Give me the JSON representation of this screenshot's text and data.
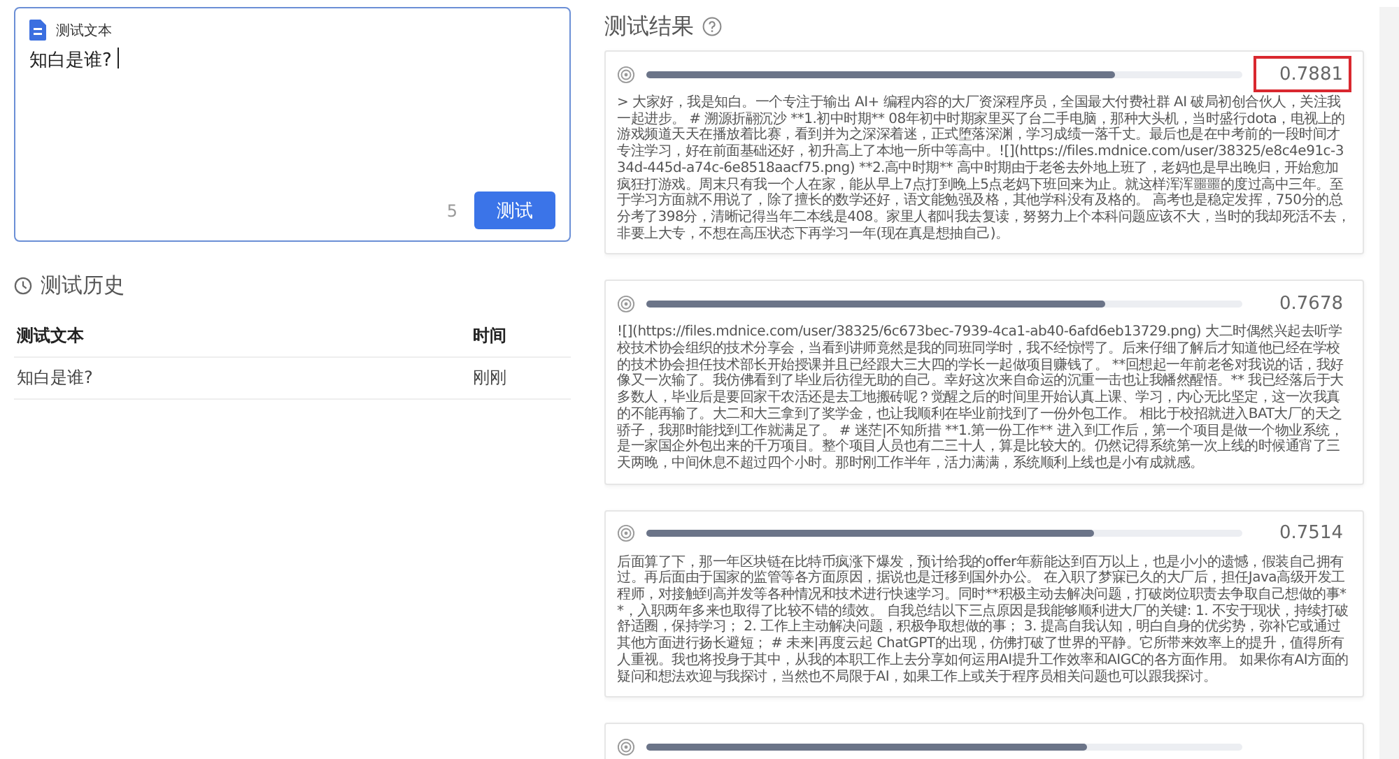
{
  "input_panel": {
    "label": "测试文本",
    "value": "知白是谁?",
    "char_count": "5",
    "button": "测试"
  },
  "history": {
    "title": "测试历史",
    "columns": [
      "测试文本",
      "时间"
    ],
    "rows": [
      {
        "text": "知白是谁?",
        "time": "刚刚"
      }
    ]
  },
  "results": {
    "title": "测试结果",
    "items": [
      {
        "score": "0.7881",
        "level": 0.786,
        "highlighted": true,
        "text": "> 大家好，我是知白。一个专注于输出 AI+ 编程内容的大厂资深程序员，全国最大付费社群 AI 破局初创合伙人，关注我一起进步。 # 溯源折翮沉沙 **1.初中时期** 08年初中时期家里买了台二手电脑，那种大头机，当时盛行dota，电视上的游戏频道天天在播放着比赛，看到并为之深深着迷，正式堕落深渊，学习成绩一落千丈。最后也是在中考前的一段时间才专注学习，好在前面基础还好，初升高上了本地一所中等高中。![](https://files.mdnice.com/user/38325/e8c4e91c-334d-445d-a74c-6e8518aacf75.png) **2.高中时期** 高中时期由于老爸去外地上班了，老妈也是早出晚归，开始愈加疯狂打游戏。周末只有我一个人在家，能从早上7点打到晚上5点老妈下班回来为止。就这样浑浑噩噩的度过高中三年。至于学习方面就不用说了，除了擅长的数学还好，语文能勉强及格，其他学科没有及格的。 高考也是稳定发挥，750分的总分考了398分，清晰记得当年二本线是408。家里人都叫我去复读，努努力上个本科问题应该不大，当时的我却死活不去，非要上大专，不想在高压状态下再学习一年(现在真是想抽自己)。"
      },
      {
        "score": "0.7678",
        "level": 0.77,
        "highlighted": false,
        "text": "![](https://files.mdnice.com/user/38325/6c673bec-7939-4ca1-ab40-6afd6eb13729.png) 大二时偶然兴起去听学校技术协会组织的技术分享会，当看到讲师竟然是我的同班同学时，我不经惊愕了。后来仔细了解后才知道他已经在学校的技术协会担任技术部长开始授课并且已经跟大三大四的学长一起做项目赚钱了。 **回想起一年前老爸对我说的话，我好像又一次输了。我仿佛看到了毕业后彷徨无助的自己。幸好这次来自命运的沉重一击也让我幡然醒悟。** 我已经落后于大多数人，毕业后是要回家干农活还是去工地搬砖呢？觉醒之后的时间里开始认真上课、学习，内心无比坚定，这一次我真的不能再输了。大二和大三拿到了奖学金，也让我顺利在毕业前找到了一份外包工作。 相比于校招就进入BAT大厂的天之骄子，我那时能找到工作就满足了。 # 迷茫|不知所措 **1.第一份工作** 进入到工作后，第一个项目是做一个物业系统，是一家国企外包出来的千万项目。整个项目人员也有二三十人，算是比较大的。仍然记得系统第一次上线的时候通宵了三天两晚，中间休息不超过四个小时。那时刚工作半年，活力满满，系统顺利上线也是小有成就感。"
      },
      {
        "score": "0.7514",
        "level": 0.752,
        "highlighted": false,
        "text": "后面算了下，那一年区块链在比特币疯涨下爆发，预计给我的offer年薪能达到百万以上，也是小小的遗憾，假装自己拥有过。再后面由于国家的监管等各方面原因，据说也是迁移到国外办公。 在入职了梦寐已久的大厂后，担任Java高级开发工程师，对接触到高并发等各种情况和技术进行快速学习。同时**积极主动去解决问题，打破岗位职责去争取自己想做的事**，入职两年多来也取得了比较不错的绩效。 自我总结以下三点原因是我能够顺利进大厂的关键: 1. 不安于现状，持续打破舒适圈，保持学习； 2. 工作上主动解决问题，积极争取想做的事； 3. 提高自我认知，明白自身的优劣势，弥补它或通过其他方面进行扬长避短； # 未来|再度云起 ChatGPT的出现，仿佛打破了世界的平静。它所带来效率上的提升，值得所有人重视。我也将投身于其中，从我的本职工作上去分享如何运用AI提升工作效率和AIGC的各方面作用。 如果你有AI方面的疑问和想法欢迎与我探讨，当然也不局限于AI，如果工作上或关于程序员相关问题也可以跟我探讨。"
      },
      {
        "level": 0.74,
        "highlighted": false
      }
    ]
  }
}
